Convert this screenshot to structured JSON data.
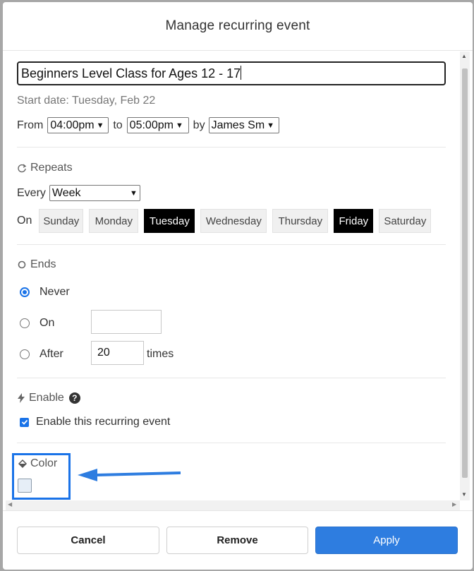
{
  "dialog": {
    "title": "Manage recurring event",
    "event_title": "Beginners Level Class for Ages 12 - 17",
    "start_date": "Start date: Tuesday, Feb 22"
  },
  "time": {
    "from_label": "From",
    "from_value": "04:00pm",
    "to_label": "to",
    "to_value": "05:00pm",
    "by_label": "by",
    "by_value": "James Sm"
  },
  "repeats": {
    "label": "Repeats",
    "every_label": "Every",
    "every_value": "Week",
    "on_label": "On",
    "days": [
      {
        "label": "Sunday",
        "selected": false
      },
      {
        "label": "Monday",
        "selected": false
      },
      {
        "label": "Tuesday",
        "selected": true
      },
      {
        "label": "Wednesday",
        "selected": false
      },
      {
        "label": "Thursday",
        "selected": false
      },
      {
        "label": "Friday",
        "selected": true
      },
      {
        "label": "Saturday",
        "selected": false
      }
    ]
  },
  "ends": {
    "label": "Ends",
    "never_label": "Never",
    "on_label": "On",
    "on_value": "",
    "after_label": "After",
    "after_value": "20",
    "times_label": "times",
    "selected": "Never"
  },
  "enable": {
    "label": "Enable",
    "help_glyph": "?",
    "checkbox_label": "Enable this recurring event",
    "checked": true
  },
  "color": {
    "label": "Color",
    "swatch": "#e6eef7"
  },
  "footer": {
    "cancel_label": "Cancel",
    "remove_label": "Remove",
    "apply_label": "Apply"
  },
  "colors": {
    "accent": "#2e7de0",
    "selected_day": "#000000",
    "highlight_box": "#1a73e8"
  }
}
